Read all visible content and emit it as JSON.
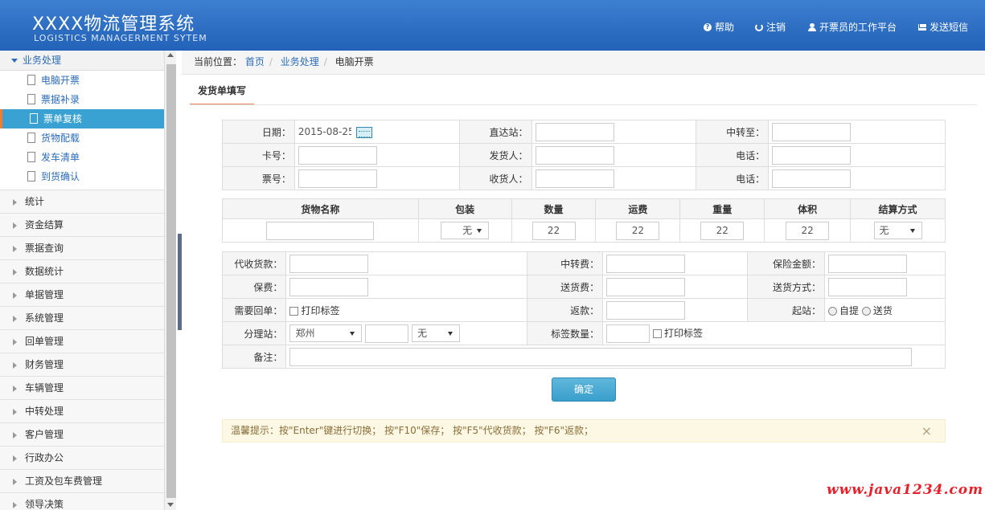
{
  "header": {
    "title": "XXXX物流管理系统",
    "subtitle": "LOGISTICS MANAGERMENT SYTEM",
    "nav": [
      {
        "label": "帮助",
        "icon": "help-icon"
      },
      {
        "label": "注销",
        "icon": "power-icon"
      },
      {
        "label": "开票员的工作平台",
        "icon": "user-icon"
      },
      {
        "label": "发送短信",
        "icon": "mail-icon"
      }
    ]
  },
  "sidebar": {
    "open_group": "业务处理",
    "sub_items": [
      "电脑开票",
      "票据补录",
      "票单复核",
      "货物配载",
      "发车清单",
      "到货确认"
    ],
    "active_sub": "票单复核",
    "groups": [
      "统计",
      "资金结算",
      "票据查询",
      "数据统计",
      "单据管理",
      "系统管理",
      "回单管理",
      "财务管理",
      "车辆管理",
      "中转处理",
      "客户管理",
      "行政办公",
      "工资及包车费管理",
      "领导决策"
    ]
  },
  "breadcrumb": {
    "prefix": "当前位置：",
    "items": [
      "首页",
      "业务处理",
      "电脑开票"
    ]
  },
  "tab": {
    "label": "发货单填写"
  },
  "form1": {
    "date_label": "日期：",
    "date_value": "2015-08-25",
    "direct_label": "直达站：",
    "transfer_to_label": "中转至：",
    "card_label": "卡号：",
    "shipper_label": "发货人：",
    "phone_label": "电话：",
    "ticket_label": "票号：",
    "receiver_label": "收货人：",
    "phone2_label": "电话："
  },
  "goods": {
    "headers": [
      "货物名称",
      "包装",
      "数量",
      "运费",
      "重量",
      "体积",
      "结算方式"
    ],
    "packing": "无",
    "quantity": "22",
    "freight": "22",
    "weight": "22",
    "volume": "22",
    "settle": "无"
  },
  "form2": {
    "cod_label": "代收货款：",
    "transfer_fee_label": "中转费：",
    "insured_label": "保险金额：",
    "premium_label": "保费：",
    "delivery_fee_label": "送货费：",
    "delivery_mode_label": "送货方式：",
    "receipt_label": "需要回单：",
    "print_label": "打印标签",
    "rebate_label": "返款：",
    "origin_label": "起站：",
    "pickup_label": "自提",
    "deliver_label": "送货",
    "branch_label": "分理站：",
    "branch_value": "郑州",
    "branch_type": "无",
    "tag_count_label": "标签数量：",
    "print2_label": "打印标签",
    "remark_label": "备注："
  },
  "confirm_label": "确定",
  "tip": {
    "text": "温馨提示：按\"Enter\"键进行切换；  按\"F10\"保存；  按\"F5\"代收货款；  按\"F6\"返款；",
    "close": "×"
  },
  "watermark": "www.java1234.com"
}
